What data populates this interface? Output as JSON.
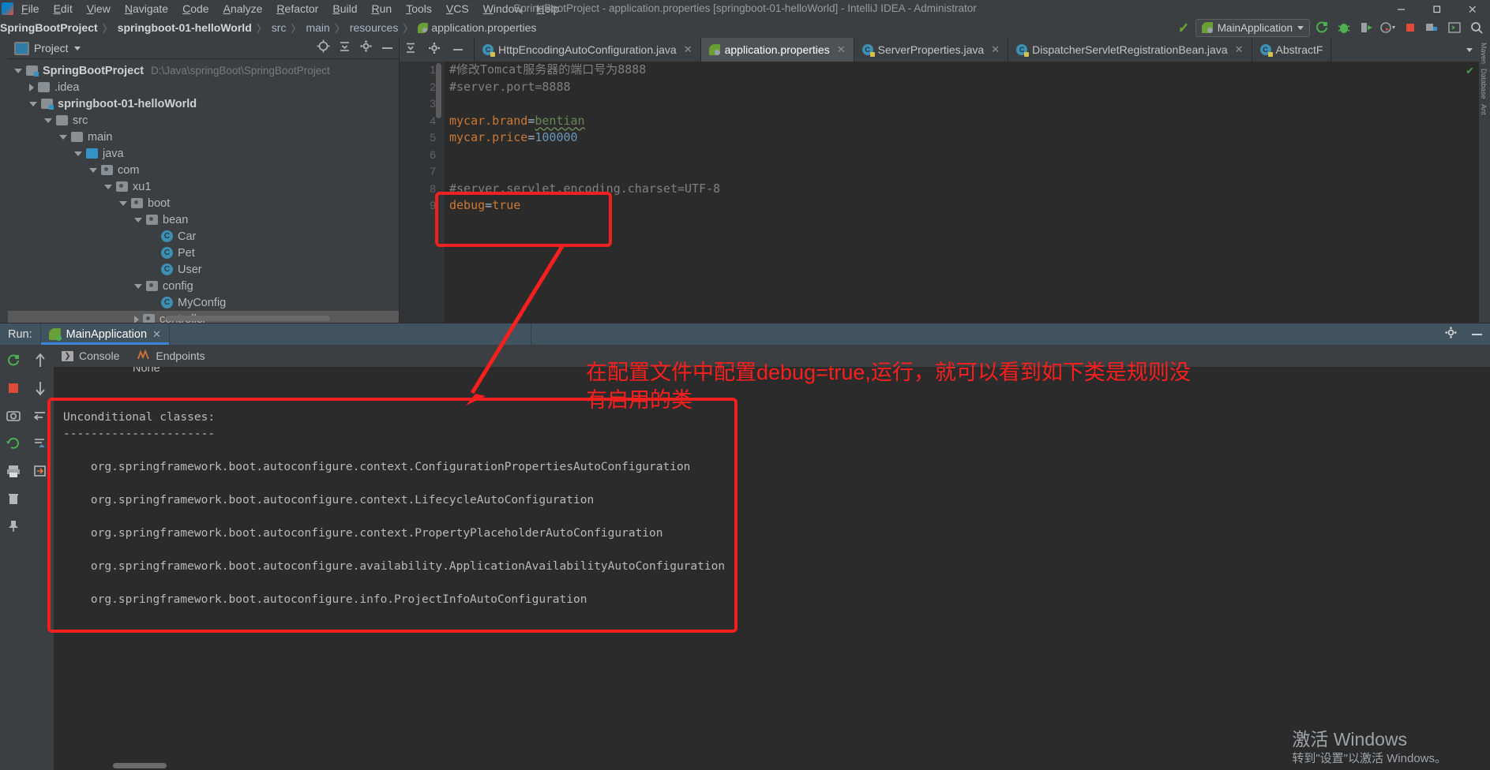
{
  "window": {
    "title": "SpringBootProject - application.properties [springboot-01-helloWorld] - IntelliJ IDEA - Administrator",
    "minimize": "─",
    "maximize": "❐",
    "close": "✕"
  },
  "menu": [
    {
      "label": "File"
    },
    {
      "label": "Edit"
    },
    {
      "label": "View"
    },
    {
      "label": "Navigate"
    },
    {
      "label": "Code"
    },
    {
      "label": "Analyze"
    },
    {
      "label": "Refactor"
    },
    {
      "label": "Build"
    },
    {
      "label": "Run"
    },
    {
      "label": "Tools"
    },
    {
      "label": "VCS"
    },
    {
      "label": "Window"
    },
    {
      "label": "Help"
    }
  ],
  "breadcrumb": {
    "items": [
      "SpringBootProject",
      "springboot-01-helloWorld",
      "src",
      "main",
      "resources"
    ],
    "leaf": "application.properties",
    "separator": "〉"
  },
  "toolbar": {
    "run_config": "MainApplication",
    "icons": [
      "build-icon",
      "run-icon",
      "debug-icon",
      "run-with-coverage-icon",
      "profiler-icon",
      "stop-icon",
      "project-structure-icon",
      "terminal-icon",
      "search-everywhere-icon"
    ]
  },
  "project_panel": {
    "title": "Project",
    "tools": [
      "locate-icon",
      "collapse-all-icon",
      "settings-icon",
      "hide-icon"
    ],
    "tree": [
      {
        "depth": 0,
        "arrow": "down",
        "icon": "module-folder",
        "label": "SpringBootProject",
        "bold": true,
        "path": "D:\\Java\\springBoot\\SpringBootProject"
      },
      {
        "depth": 1,
        "arrow": "right",
        "icon": "folder",
        "label": ".idea",
        "bold": false,
        "path": ""
      },
      {
        "depth": 1,
        "arrow": "down",
        "icon": "module-folder",
        "label": "springboot-01-helloWorld",
        "bold": true,
        "path": ""
      },
      {
        "depth": 2,
        "arrow": "down",
        "icon": "folder",
        "label": "src",
        "bold": false,
        "path": ""
      },
      {
        "depth": 3,
        "arrow": "down",
        "icon": "folder",
        "label": "main",
        "bold": false,
        "path": ""
      },
      {
        "depth": 4,
        "arrow": "down",
        "icon": "source-folder",
        "label": "java",
        "bold": false,
        "path": ""
      },
      {
        "depth": 5,
        "arrow": "down",
        "icon": "package",
        "label": "com",
        "bold": false,
        "path": ""
      },
      {
        "depth": 6,
        "arrow": "down",
        "icon": "package",
        "label": "xu1",
        "bold": false,
        "path": ""
      },
      {
        "depth": 7,
        "arrow": "down",
        "icon": "package",
        "label": "boot",
        "bold": false,
        "path": ""
      },
      {
        "depth": 8,
        "arrow": "down",
        "icon": "package",
        "label": "bean",
        "bold": false,
        "path": ""
      },
      {
        "depth": 9,
        "arrow": "none",
        "icon": "class",
        "label": "Car",
        "bold": false,
        "path": ""
      },
      {
        "depth": 9,
        "arrow": "none",
        "icon": "class",
        "label": "Pet",
        "bold": false,
        "path": ""
      },
      {
        "depth": 9,
        "arrow": "none",
        "icon": "class",
        "label": "User",
        "bold": false,
        "path": ""
      },
      {
        "depth": 8,
        "arrow": "down",
        "icon": "package",
        "label": "config",
        "bold": false,
        "path": ""
      },
      {
        "depth": 9,
        "arrow": "none",
        "icon": "class",
        "label": "MyConfig",
        "bold": false,
        "path": ""
      },
      {
        "depth": 8,
        "arrow": "right",
        "icon": "package",
        "label": "controller",
        "bold": false,
        "path": "",
        "selected": true
      }
    ]
  },
  "editor": {
    "tabs": [
      {
        "label": "HttpEncodingAutoConfiguration.java",
        "icon": "java-class-icon",
        "active": false,
        "close": "✕"
      },
      {
        "label": "application.properties",
        "icon": "spring-leaf-icon",
        "active": true,
        "close": "✕"
      },
      {
        "label": "ServerProperties.java",
        "icon": "java-class-icon",
        "active": false,
        "close": "✕"
      },
      {
        "label": "DispatcherServletRegistrationBean.java",
        "icon": "java-class-icon",
        "active": false,
        "close": "✕"
      },
      {
        "label": "AbstractF",
        "icon": "java-class-icon",
        "active": false,
        "close": ""
      }
    ],
    "tab_tools": [
      "expand-collapse-icon",
      "settings-icon",
      "hide-icon"
    ],
    "overflow": "▾",
    "line_numbers": [
      "1",
      "2",
      "3",
      "4",
      "5",
      "6",
      "7",
      "8",
      "9"
    ],
    "lines": [
      {
        "n": 1,
        "segments": [
          {
            "t": "#修改Tomcat服务器的端口号为8888",
            "c": "c-cmt"
          }
        ]
      },
      {
        "n": 2,
        "segments": [
          {
            "t": "#server.port=8888",
            "c": "c-cmt"
          }
        ]
      },
      {
        "n": 3,
        "segments": [
          {
            "t": "",
            "c": ""
          }
        ]
      },
      {
        "n": 4,
        "segments": [
          {
            "t": "mycar.brand",
            "c": "c-key"
          },
          {
            "t": "=",
            "c": "c-eq"
          },
          {
            "t": "bentian",
            "c": "c-val-str"
          }
        ]
      },
      {
        "n": 5,
        "segments": [
          {
            "t": "mycar.price",
            "c": "c-key"
          },
          {
            "t": "=",
            "c": "c-eq"
          },
          {
            "t": "100000",
            "c": "c-num"
          }
        ]
      },
      {
        "n": 6,
        "segments": [
          {
            "t": "",
            "c": ""
          }
        ]
      },
      {
        "n": 7,
        "segments": [
          {
            "t": "",
            "c": ""
          }
        ]
      },
      {
        "n": 8,
        "segments": [
          {
            "t": "#server.servlet.encoding.charset=UTF-8",
            "c": "c-cmt"
          }
        ]
      },
      {
        "n": 9,
        "segments": [
          {
            "t": "debug",
            "c": "c-key"
          },
          {
            "t": "=",
            "c": "c-eq"
          },
          {
            "t": "true",
            "c": "c-key"
          }
        ]
      }
    ],
    "inspection_status": "✔"
  },
  "right_strip": [
    "Maven",
    "Database",
    "Ant"
  ],
  "run_window": {
    "label": "Run:",
    "tab_label": "MainApplication",
    "tab_close": "✕",
    "tabs": [
      {
        "label": "Console",
        "icon": "console-icon"
      },
      {
        "label": "Endpoints",
        "icon": "endpoints-icon"
      }
    ],
    "header_icons": [
      "settings-icon",
      "hide-icon"
    ],
    "left_buttons": [
      "rerun-icon",
      "stop-icon",
      "screenshot-icon",
      "print-icon",
      "trash-icon",
      "pin-icon"
    ],
    "right_buttons": [
      "scroll-up-icon",
      "scroll-down-icon",
      "soft-wrap-icon",
      "scroll-to-end-icon",
      "unknown-icon"
    ],
    "partial_text": "None",
    "console_lines": [
      "Unconditional classes:",
      "----------------------",
      "",
      "    org.springframework.boot.autoconfigure.context.ConfigurationPropertiesAutoConfiguration",
      "",
      "    org.springframework.boot.autoconfigure.context.LifecycleAutoConfiguration",
      "",
      "    org.springframework.boot.autoconfigure.context.PropertyPlaceholderAutoConfiguration",
      "",
      "    org.springframework.boot.autoconfigure.availability.ApplicationAvailabilityAutoConfiguration",
      "",
      "    org.springframework.boot.autoconfigure.info.ProjectInfoAutoConfiguration"
    ]
  },
  "annotation": {
    "line1": "在配置文件中配置debug=true,运行，就可以看到如下类是规则没",
    "line2": "有启用的类",
    "color": "#f81f1f"
  },
  "watermark": {
    "line1": "激活 Windows",
    "line2": "转到\"设置\"以激活 Windows。"
  }
}
